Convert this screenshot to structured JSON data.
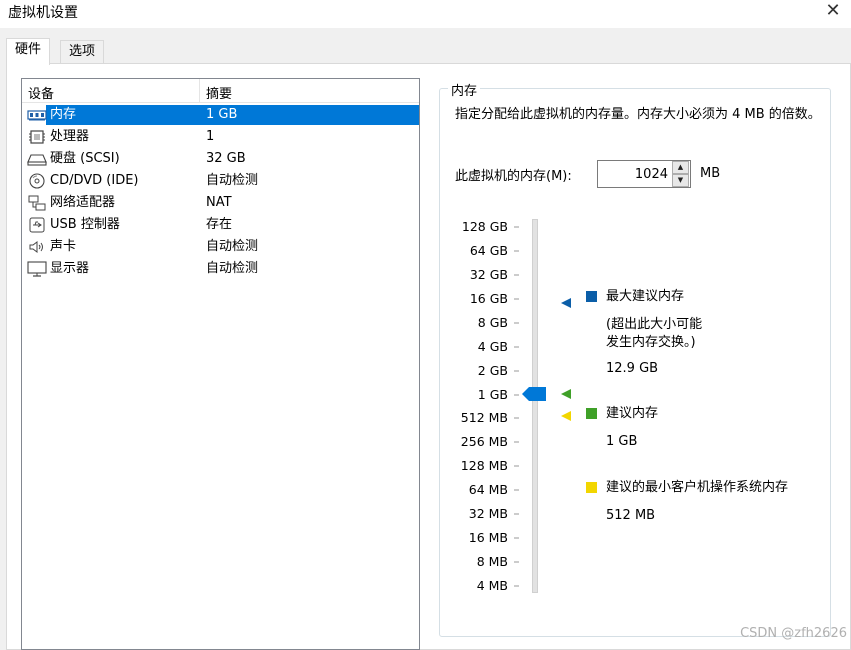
{
  "window": {
    "title": "虚拟机设置"
  },
  "tabs": [
    {
      "label": "硬件",
      "active": true
    },
    {
      "label": "选项",
      "active": false
    }
  ],
  "device_list": {
    "headers": {
      "device": "设备",
      "summary": "摘要"
    },
    "rows": [
      {
        "icon": "memory-icon",
        "name": "内存",
        "value": "1 GB",
        "selected": true
      },
      {
        "icon": "processor-icon",
        "name": "处理器",
        "value": "1"
      },
      {
        "icon": "harddisk-icon",
        "name": "硬盘 (SCSI)",
        "value": "32 GB"
      },
      {
        "icon": "cd-dvd-icon",
        "name": "CD/DVD (IDE)",
        "value": "自动检测"
      },
      {
        "icon": "network-adapter-icon",
        "name": "网络适配器",
        "value": "NAT"
      },
      {
        "icon": "usb-icon",
        "name": "USB 控制器",
        "value": "存在"
      },
      {
        "icon": "sound-card-icon",
        "name": "声卡",
        "value": "自动检测"
      },
      {
        "icon": "display-icon",
        "name": "显示器",
        "value": "自动检测"
      }
    ]
  },
  "memory": {
    "group_title": "内存",
    "description": "指定分配给此虚拟机的内存量。内存大小必须为 4 MB 的倍数。",
    "input_label": "此虚拟机的内存(M):",
    "input_value": "1024",
    "unit": "MB",
    "scale_ticks": [
      "128 GB",
      "64 GB",
      "32 GB",
      "16 GB",
      "8 GB",
      "4 GB",
      "2 GB",
      "1 GB",
      "512 MB",
      "256 MB",
      "128 MB",
      "64 MB",
      "32 MB",
      "16 MB",
      "8 MB",
      "4 MB"
    ],
    "current_tick_index": 7,
    "max_recommended": {
      "label": "最大建议内存",
      "note_line1": "(超出此大小可能",
      "note_line2": "发生内存交换。)",
      "value": "12.9 GB",
      "color": "#0b5ea8"
    },
    "recommended": {
      "label": "建议内存",
      "value": "1 GB",
      "color": "#3fa028"
    },
    "min_guest": {
      "label": "建议的最小客户机操作系统内存",
      "value": "512 MB",
      "color": "#f2d600"
    },
    "thumb_color": "#0078d7"
  },
  "watermark": "CSDN @zfh2626"
}
